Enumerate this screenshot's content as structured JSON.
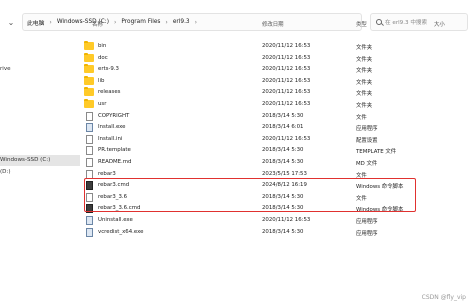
{
  "address_bar": {
    "crumbs": [
      "此电脑",
      "Windows-SSD (C:)",
      "Program Files",
      "erl9.3"
    ],
    "search_placeholder": "在 erl9.3 中搜索"
  },
  "columns": {
    "name": "名称",
    "date": "修改日期",
    "type": "类型",
    "size": "大小"
  },
  "sidebar": {
    "items": [
      "",
      "",
      "rive",
      "Windows-SSD (C:)",
      "(D:)"
    ]
  },
  "files": [
    {
      "name": "bin",
      "date": "2020/11/12 16:53",
      "type": "文件夹",
      "size": "",
      "icon": "folder-icon"
    },
    {
      "name": "doc",
      "date": "2020/11/12 16:53",
      "type": "文件夹",
      "size": "",
      "icon": "folder-icon"
    },
    {
      "name": "erts-9.3",
      "date": "2020/11/12 16:53",
      "type": "文件夹",
      "size": "",
      "icon": "folder-icon"
    },
    {
      "name": "lib",
      "date": "2020/11/12 16:53",
      "type": "文件夹",
      "size": "",
      "icon": "folder-icon"
    },
    {
      "name": "releases",
      "date": "2020/11/12 16:53",
      "type": "文件夹",
      "size": "",
      "icon": "folder-icon"
    },
    {
      "name": "usr",
      "date": "2020/11/12 16:53",
      "type": "文件夹",
      "size": "",
      "icon": "folder-icon"
    },
    {
      "name": "COPYRIGHT",
      "date": "2018/3/14 5:30",
      "type": "文件",
      "size": "",
      "icon": "file-icon"
    },
    {
      "name": "Install.exe",
      "date": "2018/3/14 6:01",
      "type": "应用程序",
      "size": "",
      "icon": "exe-icon"
    },
    {
      "name": "Install.ini",
      "date": "2020/11/12 16:53",
      "type": "配置设置",
      "size": "",
      "icon": "file-icon"
    },
    {
      "name": "PR.template",
      "date": "2018/3/14 5:30",
      "type": "TEMPLATE 文件",
      "size": "",
      "icon": "file-icon"
    },
    {
      "name": "README.md",
      "date": "2018/3/14 5:30",
      "type": "MD 文件",
      "size": "",
      "icon": "file-icon"
    },
    {
      "name": "rebar3",
      "date": "2023/5/15 17:53",
      "type": "文件",
      "size": "",
      "icon": "file-icon"
    },
    {
      "name": "rebar3.cmd",
      "date": "2024/8/12 16:19",
      "type": "Windows 命令脚本",
      "size": "",
      "icon": "cmd-icon"
    },
    {
      "name": "rebar3_3.6",
      "date": "2018/3/14 5:30",
      "type": "文件",
      "size": "",
      "icon": "file-icon"
    },
    {
      "name": "rebar3_3.6.cmd",
      "date": "2018/3/14 5:30",
      "type": "Windows 命令脚本",
      "size": "",
      "icon": "cmd-icon"
    },
    {
      "name": "Uninstall.exe",
      "date": "2020/11/12 16:53",
      "type": "应用程序",
      "size": "",
      "icon": "exe-icon"
    },
    {
      "name": "vcredist_x64.exe",
      "date": "2018/3/14 5:30",
      "type": "应用程序",
      "size": "",
      "icon": "exe-icon"
    }
  ],
  "watermark": "CSDN @fly_vip",
  "colors": {
    "highlight_border": "#e0312f",
    "folder": "#ffca28",
    "selected_bg": "#e5e5e5"
  }
}
